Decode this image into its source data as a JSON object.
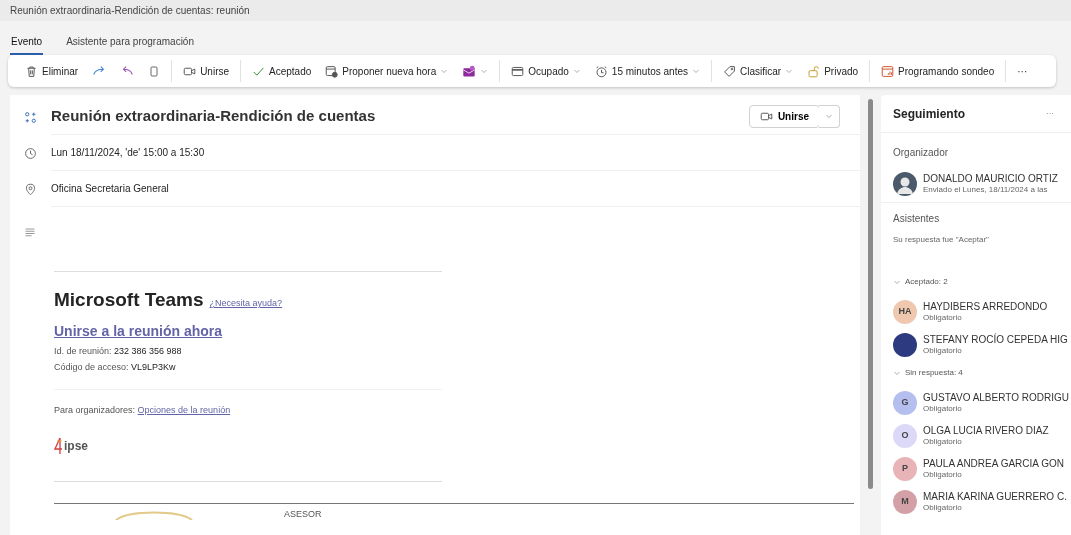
{
  "window": {
    "title": "Reunión extraordinaria-Rendición de cuentas: reunión"
  },
  "tabs": [
    {
      "label": "Evento",
      "selected": true
    },
    {
      "label": "Asistente para programación",
      "selected": false
    }
  ],
  "toolbar": [
    [
      {
        "kind": "trash",
        "label": "Eliminar",
        "dropdown": false
      },
      {
        "kind": "forward",
        "dropdown": false
      },
      {
        "kind": "reply",
        "dropdown": false
      },
      {
        "kind": "copy",
        "dropdown": false
      }
    ],
    [
      {
        "kind": "video",
        "label": "Unirse",
        "dropdown": false
      }
    ],
    [
      {
        "kind": "check",
        "label": "Aceptado",
        "dropdown": false
      },
      {
        "kind": "propose",
        "label": "Proponer nueva hora",
        "dropdown": true
      },
      {
        "kind": "envelope",
        "dropdown": true
      }
    ],
    [
      {
        "kind": "busy",
        "label": "Ocupado",
        "dropdown": true
      },
      {
        "kind": "alarm",
        "label": "15 minutos antes",
        "dropdown": true
      }
    ],
    [
      {
        "kind": "tag",
        "label": "Clasificar",
        "dropdown": true
      },
      {
        "kind": "lock",
        "label": "Privado",
        "dropdown": false
      }
    ],
    [
      {
        "kind": "poll",
        "label": "Programando sondeo",
        "dropdown": false
      }
    ],
    [
      {
        "kind": "more",
        "label": "···",
        "dropdown": false
      }
    ]
  ],
  "event": {
    "title": "Reunión extraordinaria-Rendición de cuentas",
    "join_button": "Unirse",
    "when": "Lun 18/11/2024, 'de' 15:00 a 15:30",
    "location": "Oficina Secretaria General"
  },
  "body": {
    "app": "Microsoft Teams",
    "help_link": "¿Necesita ayuda?",
    "join_link": "Unirse a la reunión ahora",
    "meeting_id_label": "Id. de reunión:",
    "meeting_id": "232 386 356 988",
    "passcode_label": "Código de acceso:",
    "passcode": "VL9LP3Kw",
    "organizers_label": "Para organizadores:",
    "options_link": "Opciones de la reunión",
    "logo_text": "ipse",
    "signature_title": "ASESOR"
  },
  "tracking": {
    "title": "Seguimiento",
    "menu": "···",
    "organizer_heading": "Organizador",
    "organizer": {
      "name": "DONALDO MAURICIO ORTIZ",
      "sent": "Enviado el Lunes, 18/11/2024 a las"
    },
    "attendees_heading": "Asistentes",
    "response": "Su respuesta fue \"Aceptar\"",
    "groups": [
      {
        "label": "Aceptado: 2",
        "expanded": true,
        "people": [
          {
            "initials": "HA",
            "name": "HAYDIBERS ARREDONDO",
            "role": "Obligatorio",
            "color": "#f0c8b0"
          },
          {
            "name": "STEFANY ROCÍO CEPEDA HIG",
            "role": "Obligatorio",
            "color": "#2d3a80"
          }
        ]
      },
      {
        "label": "Sin respuesta: 4",
        "expanded": true,
        "people": [
          {
            "initials": "G",
            "name": "GUSTAVO ALBERTO RODRIGU",
            "role": "Obligatorio",
            "color": "#b4bff0"
          },
          {
            "initials": "O",
            "name": "OLGA LUCIA RIVERO DIAZ",
            "role": "Obligatorio",
            "color": "#dcd8f8"
          },
          {
            "initials": "P",
            "name": "PAULA ANDREA GARCIA GON",
            "role": "Obligatorio",
            "color": "#e8b4b8"
          },
          {
            "initials": "M",
            "name": "MARIA KARINA GUERRERO C.",
            "role": "Obligatorio",
            "color": "#d4a0a8"
          }
        ]
      }
    ]
  }
}
